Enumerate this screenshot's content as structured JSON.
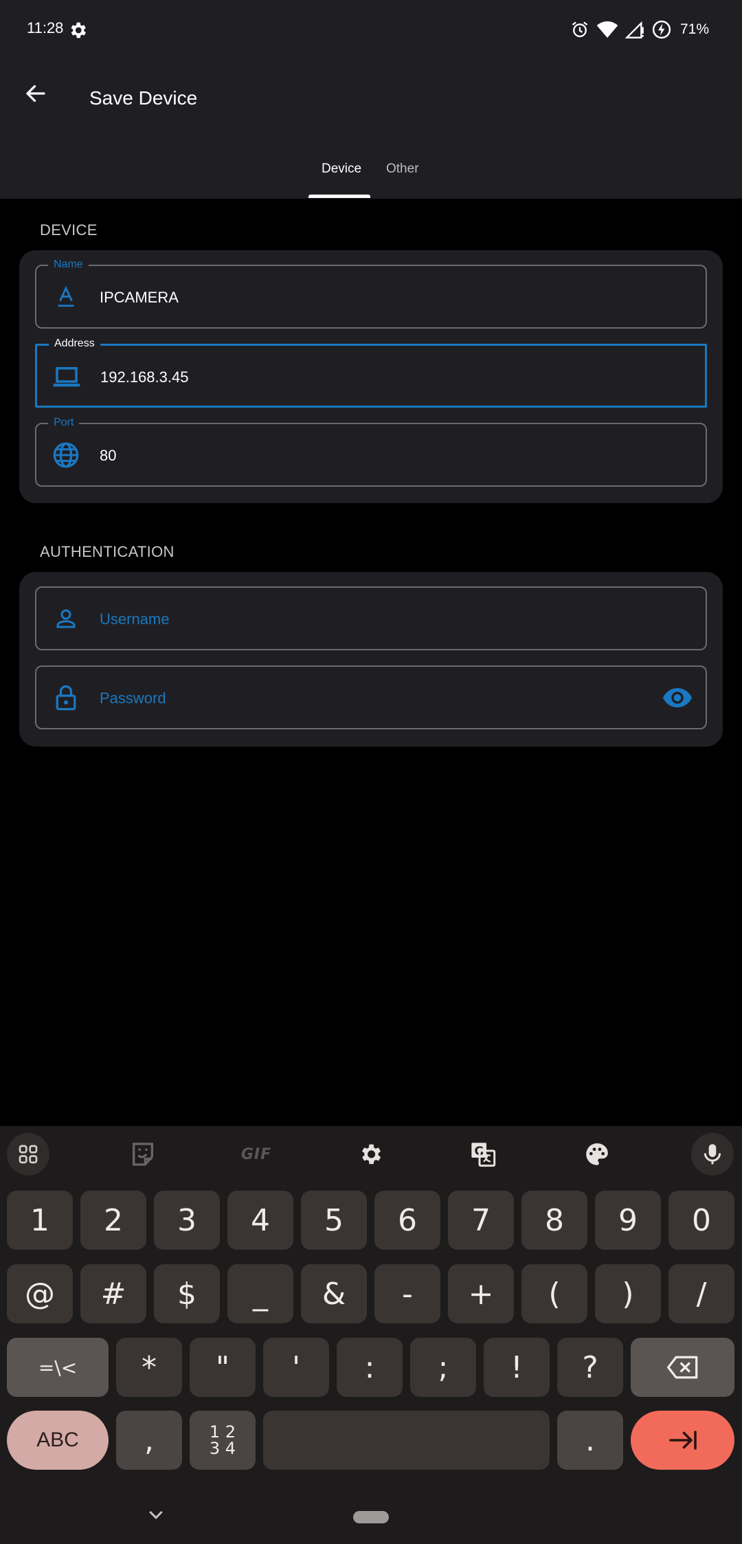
{
  "status_bar": {
    "time": "11:28",
    "battery": "71%"
  },
  "header": {
    "title": "Save Device"
  },
  "tabs": [
    {
      "label": "Device"
    },
    {
      "label": "Other"
    }
  ],
  "sections": {
    "device": {
      "label": "DEVICE",
      "fields": {
        "name": {
          "label": "Name",
          "value": "IPCAMERA",
          "icon": "text-format-icon"
        },
        "address": {
          "label": "Address",
          "value": "192.168.3.45",
          "icon": "laptop-icon"
        },
        "port": {
          "label": "Port",
          "value": "80",
          "icon": "globe-icon"
        }
      }
    },
    "authentication": {
      "label": "AUTHENTICATION",
      "fields": {
        "username": {
          "placeholder": "Username",
          "icon": "person-icon"
        },
        "password": {
          "placeholder": "Password",
          "icon": "lock-icon",
          "trailing_icon": "eye-icon"
        }
      }
    }
  },
  "keyboard": {
    "toolbar": [
      "apps-grid-icon",
      "sticker-icon",
      "GIF",
      "settings-icon",
      "translate-icon",
      "palette-icon",
      "mic-icon"
    ],
    "row1": [
      "1",
      "2",
      "3",
      "4",
      "5",
      "6",
      "7",
      "8",
      "9",
      "0"
    ],
    "row2": [
      "@",
      "#",
      "$",
      "_",
      "&",
      "-",
      "+",
      "(",
      ")",
      "/"
    ],
    "row3": [
      "=\\<",
      "*",
      "\"",
      "'",
      ":",
      ";",
      "!",
      "?"
    ],
    "row4": {
      "abc": "ABC",
      "comma": ",",
      "numpad_top": "1 2",
      "numpad_bottom": "3 4",
      "period": "."
    }
  },
  "colors": {
    "accent": "#1a78c2",
    "surface": "#1f1f23",
    "background": "#000000",
    "enter_key": "#f26b5a"
  }
}
